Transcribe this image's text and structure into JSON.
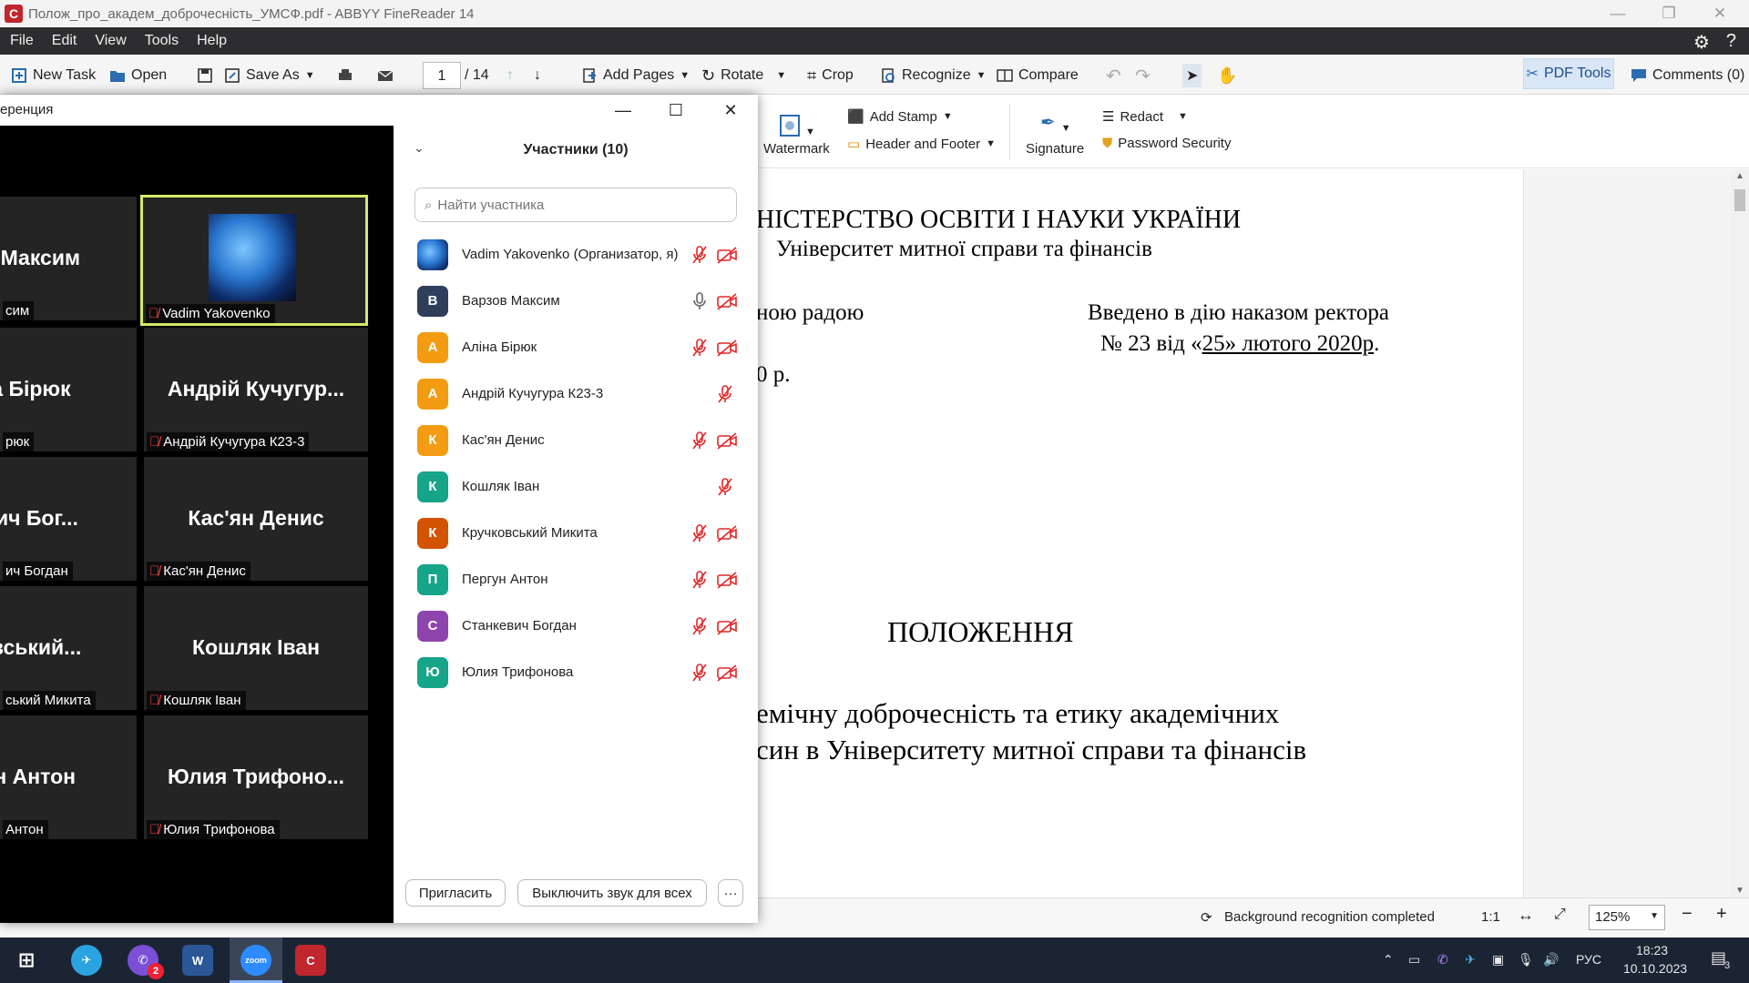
{
  "app": {
    "title": "Полож_про_академ_доброчесність_УМСФ.pdf - ABBYY FineReader 14",
    "icon": "finereader-logo-icon"
  },
  "menu": [
    "File",
    "Edit",
    "View",
    "Tools",
    "Help"
  ],
  "toolbar": {
    "new_task": "New Task",
    "open": "Open",
    "save_as": "Save As",
    "page_current": "1",
    "page_total": "/ 14",
    "add_pages": "Add Pages",
    "rotate": "Rotate",
    "crop": "Crop",
    "recognize": "Recognize",
    "compare": "Compare",
    "pdf_tools": "PDF Tools",
    "comments": "Comments (0)"
  },
  "ribbon": {
    "watermark": "Watermark",
    "add_stamp": "Add Stamp",
    "header_footer": "Header and Footer",
    "signature": "Signature",
    "redact": "Redact",
    "password_security": "Password Security"
  },
  "document": {
    "ministry": "НІСТЕРСТВО ОСВІТИ І НАУКИ УКРАЇНИ",
    "university": "Університет митної справи та фінансів",
    "left_1": "ною радою",
    "left_2": "0 р.",
    "right_1": "Введено в дію наказом ректора",
    "right_2_prefix": "№ 23 від «",
    "right_2_date": "25»  лютого  2020р",
    "right_2_suffix": ".",
    "heading": "ПОЛОЖЕННЯ",
    "line_1": "емічну доброчесність та етику академічних",
    "line_2": "син в Університету митної справи та фінансів"
  },
  "status": {
    "recognition": "Background recognition completed",
    "ratio": "1:1",
    "zoom": "125%"
  },
  "zoom": {
    "window_title": "еренция",
    "participants_header": "Участники (10)",
    "search_placeholder": "Найти участника",
    "invite": "Пригласить",
    "mute_all": "Выключить звук для всех",
    "more": "···",
    "tiles": [
      {
        "big": "ов Максим",
        "label": "сим"
      },
      {
        "big": "",
        "label": "Vadim Yakovenko"
      },
      {
        "big": "на Бірюк",
        "label": "рюк"
      },
      {
        "big": "Андрій  Кучугур...",
        "label": "Андрій Кучугура К23-3"
      },
      {
        "big": "евич  Бог...",
        "label": "ич Богдан"
      },
      {
        "big": "Кас'ян Денис",
        "label": "Кас'ян Денис"
      },
      {
        "big": "ковський...",
        "label": "ський Микита"
      },
      {
        "big": "Кошляк Іван",
        "label": "Кошляк Іван"
      },
      {
        "big": "гун Антон",
        "label": "Антон"
      },
      {
        "big": "Юлия  Трифоно...",
        "label": "Юлия Трифонова"
      }
    ],
    "participants": [
      {
        "initial": "",
        "name": "Vadim Yakovenko (Организатор, я)",
        "color": "#2a78d1",
        "mic": "muted",
        "cam": "off"
      },
      {
        "initial": "В",
        "name": "Варзов Максим",
        "color": "#2e3f5c",
        "mic": "on",
        "cam": "off"
      },
      {
        "initial": "А",
        "name": "Аліна Бірюк",
        "color": "#f39c12",
        "mic": "muted",
        "cam": "off"
      },
      {
        "initial": "А",
        "name": "Андрій Кучугура К23-3",
        "color": "#f39c12",
        "mic": "muted",
        "cam": "none"
      },
      {
        "initial": "К",
        "name": "Кас'ян Денис",
        "color": "#f39c12",
        "mic": "muted",
        "cam": "off"
      },
      {
        "initial": "К",
        "name": "Кошляк Іван",
        "color": "#17a589",
        "mic": "muted",
        "cam": "none"
      },
      {
        "initial": "К",
        "name": "Кручковський Микита",
        "color": "#d35400",
        "mic": "muted",
        "cam": "off"
      },
      {
        "initial": "П",
        "name": "Пергун Антон",
        "color": "#17a589",
        "mic": "muted",
        "cam": "off"
      },
      {
        "initial": "С",
        "name": "Станкевич Богдан",
        "color": "#8e44ad",
        "mic": "muted",
        "cam": "off"
      },
      {
        "initial": "Ю",
        "name": "Юлия Трифонова",
        "color": "#17a589",
        "mic": "muted",
        "cam": "off"
      }
    ]
  },
  "taskbar": {
    "viber_badge": "2",
    "lang": "РУС",
    "time": "18:23",
    "date": "10.10.2023",
    "notif_count": "3"
  },
  "colors": {
    "menubar_bg": "#2d2d30",
    "zoom_active_border": "#d6e86a",
    "muted_red": "#e02828",
    "taskbar_bg": "#1b2433"
  }
}
